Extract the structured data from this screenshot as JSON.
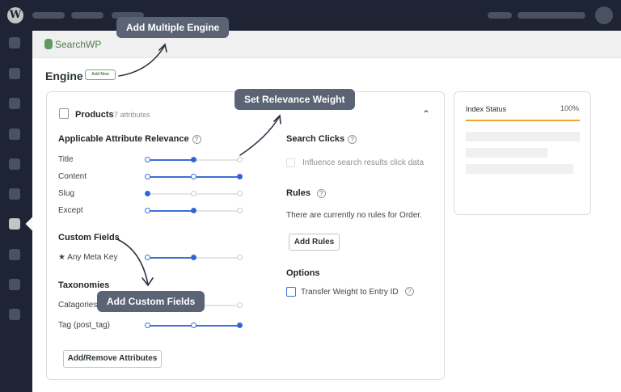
{
  "brand": "SearchWP",
  "engine": {
    "title": "Engine",
    "add_new": "Add New"
  },
  "source": {
    "name": "Products",
    "count": "7 attributes"
  },
  "relevance": {
    "heading": "Applicable Attribute Relevance",
    "rows": [
      {
        "label": "Title",
        "level": 2
      },
      {
        "label": "Content",
        "level": 3
      },
      {
        "label": "Slug",
        "level": 1
      },
      {
        "label": "Except",
        "level": 2
      }
    ]
  },
  "custom_fields": {
    "heading": "Custom Fields",
    "rows": [
      {
        "label": "★ Any Meta Key",
        "level": 2
      }
    ]
  },
  "taxonomies": {
    "heading": "Taxonomies",
    "rows": [
      {
        "label": "Catagories",
        "level": 2
      },
      {
        "label": "Tag (post_tag)",
        "level": 3
      }
    ]
  },
  "add_remove": "Add/Remove Attributes",
  "search_clicks": {
    "heading": "Search Clicks",
    "checkbox": "Influence search results click data"
  },
  "rules": {
    "heading": "Rules",
    "empty": "There are currently no rules for Order.",
    "button": "Add Rules"
  },
  "options": {
    "heading": "Options",
    "checkbox": "Transfer Weight to Entry ID"
  },
  "index": {
    "title": "Index Status",
    "percent": "100%",
    "progress": 1.0,
    "color": "#f0a429"
  },
  "callouts": {
    "engine": "Add Multiple Engine",
    "relevance": "Set Relevance Weight",
    "custom": "Add Custom Fields"
  },
  "accent": "#3b6fd6"
}
